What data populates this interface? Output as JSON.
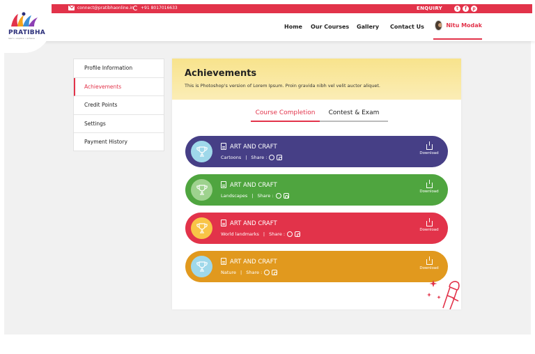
{
  "topbar": {
    "email": "connect@pratibhaonline.in",
    "phone": "+91 8017016633",
    "enquiry": "ENQUIRY",
    "social": [
      "Tw",
      "f",
      "in"
    ]
  },
  "brand": {
    "name": "PRATIBHA",
    "tagline": "learn • explore • achieve"
  },
  "nav": {
    "items": [
      "Home",
      "Our Courses",
      "Gallery",
      "Contact Us"
    ],
    "user_name": "Nitu Modak"
  },
  "sidebar": {
    "items": [
      {
        "label": "Profile Information",
        "active": false
      },
      {
        "label": "Achievements",
        "active": true
      },
      {
        "label": "Credit Points",
        "active": false
      },
      {
        "label": "Settings",
        "active": false
      },
      {
        "label": "Payment History",
        "active": false
      }
    ]
  },
  "main": {
    "title": "Achievements",
    "subtitle": "This is Photoshop's version  of Lorem Ipsum. Proin gravida nibh vel velit auctor aliquet.",
    "tabs": [
      {
        "label": "Course Completion",
        "active": true
      },
      {
        "label": "Contest & Exam",
        "active": false
      }
    ],
    "share_label": "Share :",
    "download_label": "Download",
    "cards": [
      {
        "title": "ART AND CRAFT",
        "category": "Cartoons",
        "color": "#463f86"
      },
      {
        "title": "ART AND CRAFT",
        "category": "Landscapes",
        "color": "#4fa53f"
      },
      {
        "title": "ART AND CRAFT",
        "category": "World landmarks",
        "color": "#e2334a"
      },
      {
        "title": "ART AND CRAFT",
        "category": "Nature",
        "color": "#e1991e"
      }
    ]
  },
  "colors": {
    "accent": "#e2334a",
    "banner": "#f8e38c",
    "navy": "#2b2f7a"
  }
}
